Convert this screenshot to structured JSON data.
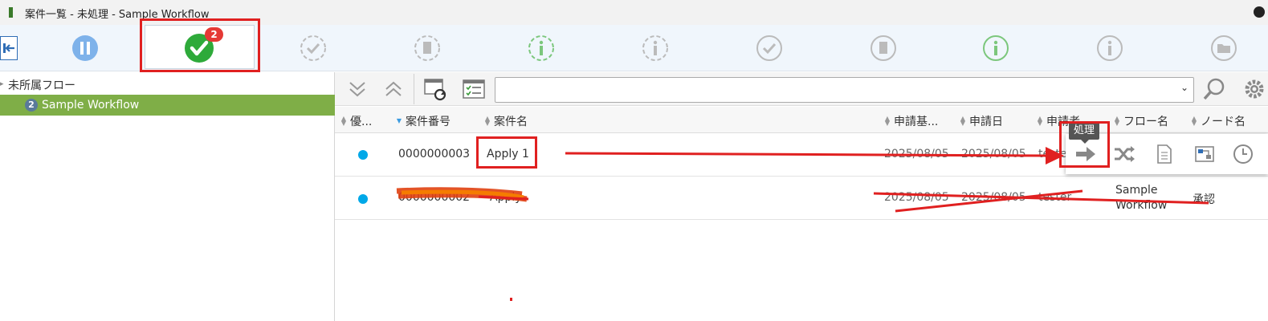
{
  "window": {
    "title": "案件一覧 - 未処理 - Sample Workflow"
  },
  "status_tabs": {
    "active_badge": "2",
    "items": [
      {
        "icon": "pause-circle-icon",
        "color": "#6aa8e8"
      },
      {
        "icon": "check-circle-icon",
        "color": "#2eaa3a"
      },
      {
        "icon": "check-dashed-icon",
        "color": "#b8b8b8"
      },
      {
        "icon": "document-dashed-icon",
        "color": "#b8b8b8"
      },
      {
        "icon": "info-dashed-green-icon",
        "color": "#7cc77c"
      },
      {
        "icon": "info-dashed-icon",
        "color": "#b8b8b8"
      },
      {
        "icon": "check-outline-icon",
        "color": "#b8b8b8"
      },
      {
        "icon": "document-outline-icon",
        "color": "#b8b8b8"
      },
      {
        "icon": "info-outline-green-icon",
        "color": "#7cc77c"
      },
      {
        "icon": "info-outline-icon",
        "color": "#b8b8b8"
      },
      {
        "icon": "folder-outline-icon",
        "color": "#b8b8b8"
      }
    ]
  },
  "tree": {
    "root_label": "未所属フロー",
    "selected": {
      "count": "2",
      "label": "Sample Workflow"
    }
  },
  "table": {
    "columns": [
      "優...",
      "案件番号",
      "案件名",
      "申請基...",
      "申請日",
      "申請者",
      "フロー名",
      "ノード名"
    ],
    "rows": [
      {
        "case_number": "0000000003",
        "case_name": "Apply 1",
        "basis_date": "2025/08/05",
        "apply_date": "2025/08/05",
        "applicant": "tester"
      },
      {
        "case_number": "0000000002",
        "case_name": "Apply",
        "basis_date": "2025/08/05",
        "apply_date": "2025/08/05",
        "applicant": "tester",
        "flow_name_line1": "Sample",
        "flow_name_line2": "Workflow",
        "node_name": "承認"
      }
    ]
  },
  "action_popup": {
    "tooltip": "処理",
    "actions": [
      "process-arrow-icon",
      "shuffle-icon",
      "document-icon",
      "flow-diagram-icon",
      "history-clock-icon"
    ]
  },
  "colors": {
    "accent_green": "#7fae47",
    "badge_red": "#e53935",
    "annotation_red": "#e02020",
    "dot_blue": "#00a8e8"
  }
}
